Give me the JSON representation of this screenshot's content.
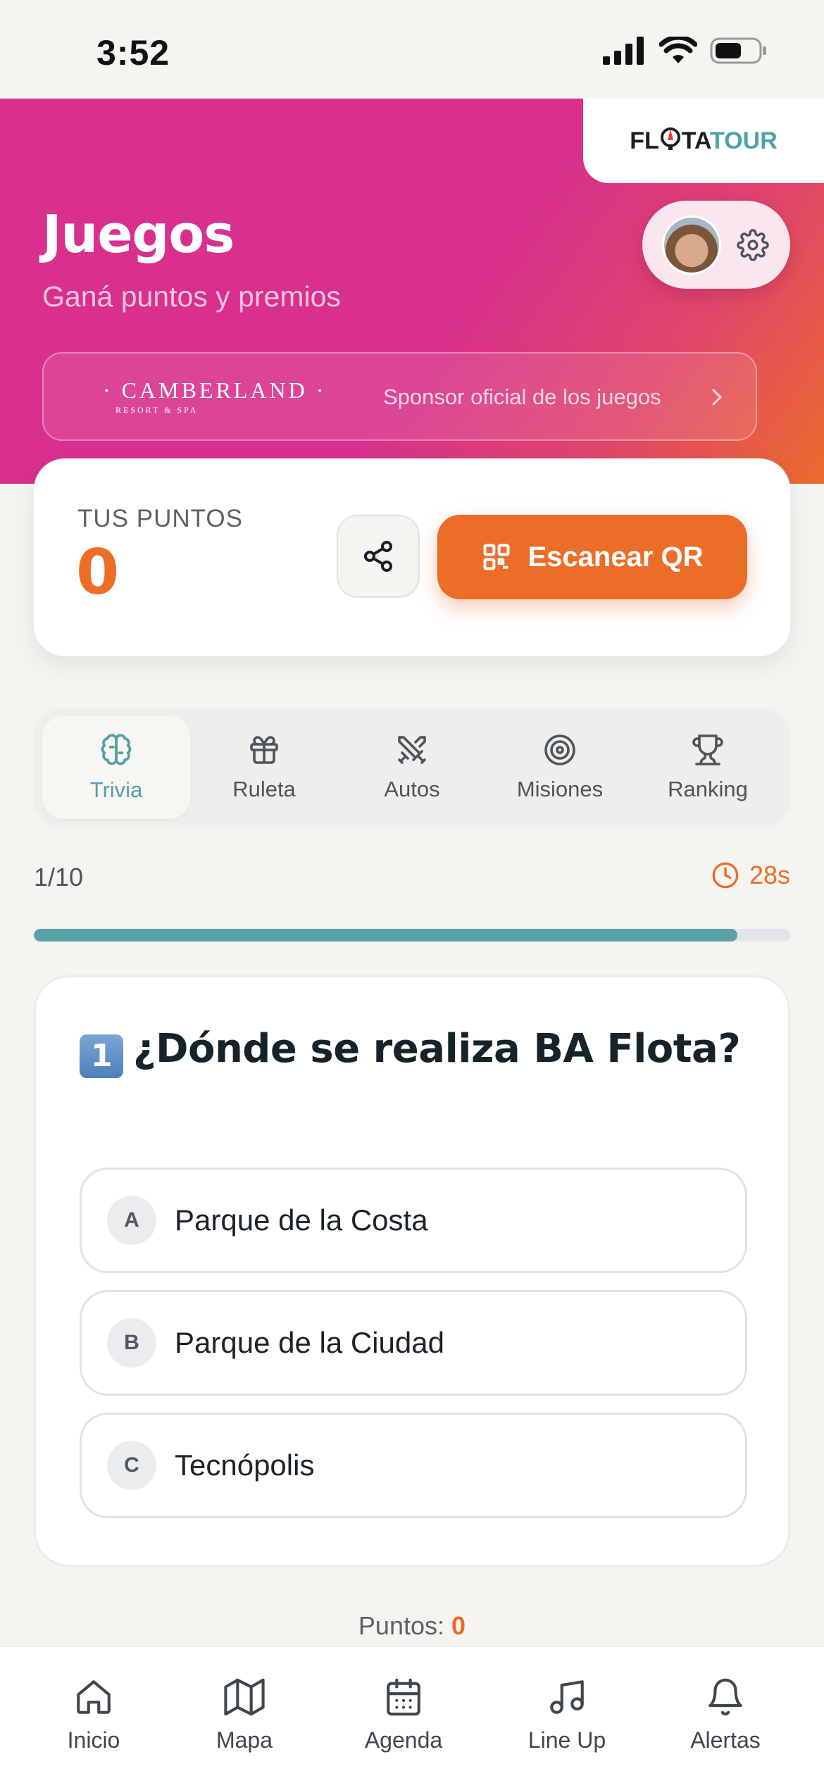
{
  "status_bar": {
    "time": "3:52"
  },
  "brand": {
    "part1": "FL",
    "part2": "TA",
    "part3": "TOUR"
  },
  "header": {
    "title": "Juegos",
    "subtitle": "Ganá puntos y premios"
  },
  "sponsor": {
    "logo_text": "· CAMBERLAND ·",
    "logo_subtext": "RESORT & SPA",
    "label": "Sponsor oficial de los juegos"
  },
  "points_card": {
    "label": "TUS PUNTOS",
    "value": "0",
    "scan_button_label": "Escanear QR"
  },
  "tabs": [
    {
      "label": "Trivia",
      "icon": "brain-icon",
      "active": true
    },
    {
      "label": "Ruleta",
      "icon": "gift-icon",
      "active": false
    },
    {
      "label": "Autos",
      "icon": "crossed-swords-icon",
      "active": false
    },
    {
      "label": "Misiones",
      "icon": "target-icon",
      "active": false
    },
    {
      "label": "Ranking",
      "icon": "trophy-icon",
      "active": false
    }
  ],
  "progress": {
    "counter": "1/10",
    "timer": "28s",
    "fill_fraction": 0.93
  },
  "question": {
    "number_badge": "1",
    "text": "¿Dónde se realiza BA Flota?",
    "options": [
      {
        "letter": "A",
        "text": "Parque de la Costa"
      },
      {
        "letter": "B",
        "text": "Parque de la Ciudad"
      },
      {
        "letter": "C",
        "text": "Tecnópolis"
      }
    ]
  },
  "footer_points": {
    "label": "Puntos:",
    "value": "0"
  },
  "bottom_nav": [
    {
      "label": "Inicio",
      "icon": "home-icon"
    },
    {
      "label": "Mapa",
      "icon": "map-icon"
    },
    {
      "label": "Agenda",
      "icon": "calendar-icon"
    },
    {
      "label": "Line Up",
      "icon": "music-icon"
    },
    {
      "label": "Alertas",
      "icon": "bell-icon"
    }
  ],
  "colors": {
    "hero_magenta": "#d8308c",
    "hero_orange": "#ec6b2b",
    "accent_orange": "#ec6d28",
    "accent_teal": "#5aa2a8",
    "background": "#f5f4f1"
  }
}
